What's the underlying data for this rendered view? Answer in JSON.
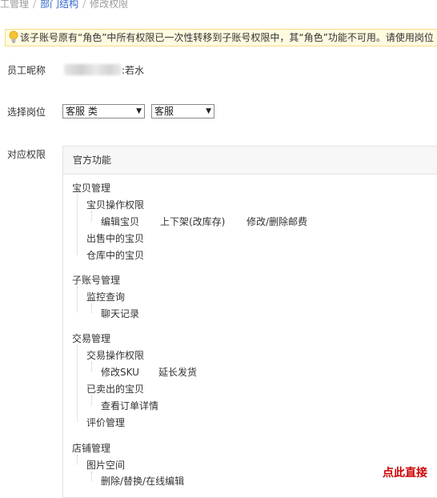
{
  "breadcrumb": {
    "item1": "员工管理",
    "item2": "部门结构",
    "item3": "修改权限"
  },
  "notice": {
    "text": "该子账号原有“角色”中所有权限已一次性转移到子账号权限中，其“角色”功能不可用。请使用岗位"
  },
  "form": {
    "nickname_label": "员工昵称",
    "nickname_suffix": ":若水",
    "position_label": "选择岗位",
    "position_category": "客服 类",
    "position_role": "客服",
    "permissions_label": "对应权限"
  },
  "permissions": {
    "panel_title": "官方功能",
    "g1": {
      "title": "宝贝管理",
      "a": "宝贝操作权限",
      "a1": "编辑宝贝",
      "a2": "上下架(改库存)",
      "a3": "修改/删除邮费",
      "b": "出售中的宝贝",
      "c": "仓库中的宝贝"
    },
    "g2": {
      "title": "子账号管理",
      "a": "监控查询",
      "a1": "聊天记录"
    },
    "g3": {
      "title": "交易管理",
      "a": "交易操作权限",
      "a1": "修改SKU",
      "a2": "延长发货",
      "b": "已卖出的宝贝",
      "b1": "查看订单详情",
      "c": "评价管理"
    },
    "g4": {
      "title": "店铺管理",
      "a": "图片空间",
      "a1": "删除/替换/在线编辑"
    }
  },
  "cta": {
    "text": "点此直接"
  },
  "colors": {
    "link": "#3366cc",
    "notice_bg": "#fffbe0",
    "notice_border": "#f5dd87",
    "cta": "#cc0000"
  },
  "icons": {
    "notice": "lightbulb-icon"
  }
}
